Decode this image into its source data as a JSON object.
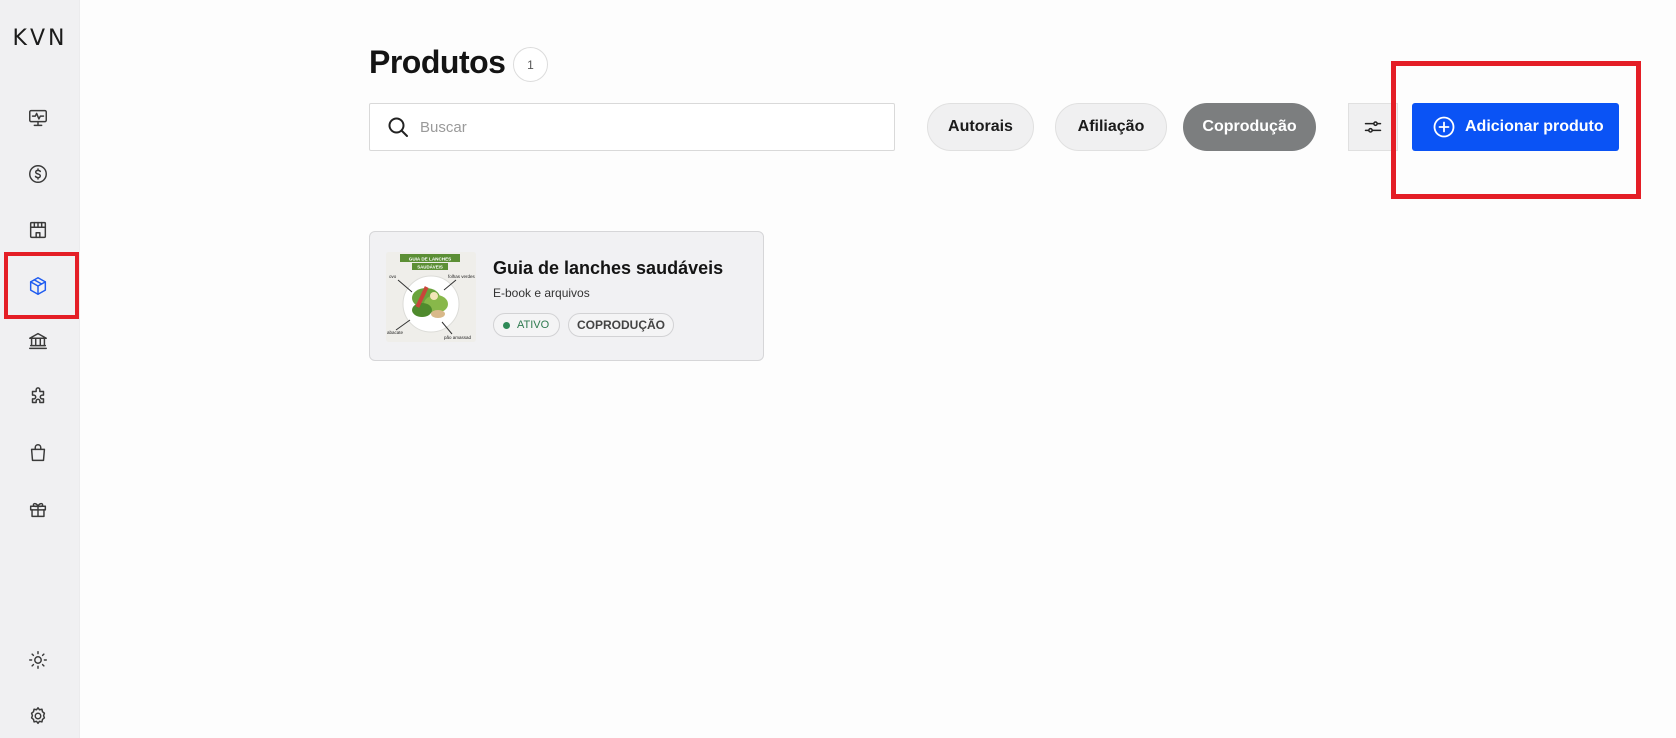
{
  "sidebar": {
    "logo": "KVN",
    "items": [
      {
        "name": "dashboard",
        "icon": "monitor-pulse-icon"
      },
      {
        "name": "finance",
        "icon": "dollar-circle-icon"
      },
      {
        "name": "store",
        "icon": "storefront-icon"
      },
      {
        "name": "products",
        "icon": "box-icon",
        "active": true
      },
      {
        "name": "bank",
        "icon": "bank-icon"
      },
      {
        "name": "integrations",
        "icon": "puzzle-icon"
      },
      {
        "name": "shopping",
        "icon": "shopping-bag-icon"
      },
      {
        "name": "rewards",
        "icon": "gift-icon"
      }
    ],
    "bottom_items": [
      {
        "name": "theme",
        "icon": "sun-icon"
      },
      {
        "name": "settings",
        "icon": "gear-icon"
      }
    ]
  },
  "header": {
    "title": "Produtos",
    "count": "1"
  },
  "search": {
    "placeholder": "Buscar",
    "value": ""
  },
  "filters": {
    "chips": [
      {
        "label": "Autorais",
        "selected": false
      },
      {
        "label": "Afiliação",
        "selected": false
      },
      {
        "label": "Coprodução",
        "selected": true
      }
    ]
  },
  "actions": {
    "add_product_label": "Adicionar produto"
  },
  "products": [
    {
      "title": "Guia de lanches saudáveis",
      "subtitle": "E-book e arquivos",
      "status": "ATIVO",
      "type": "COPRODUÇÃO",
      "thumbnail": {
        "banner_line1": "GUIA DE LANCHES",
        "banner_line2": "SAUDÁVEIS",
        "labels": [
          "ovo",
          "folhas verdes",
          "abacate",
          "pão amassad"
        ]
      }
    }
  ],
  "colors": {
    "accent": "#0a53f5",
    "active_icon": "#1f5cf0",
    "selected_chip": "#7c7e7f",
    "status_green": "#2f8a57",
    "highlight": "#e41e26"
  }
}
